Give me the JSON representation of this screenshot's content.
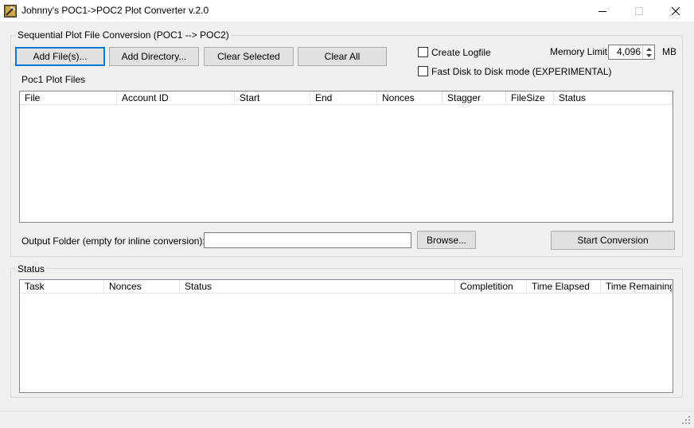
{
  "window": {
    "title": "Johnny's POC1->POC2 Plot Converter v.2.0"
  },
  "conversion_group": {
    "label": "Sequential Plot File Conversion (POC1 --> POC2)",
    "buttons": {
      "add_files": "Add File(s)...",
      "add_directory": "Add Directory...",
      "clear_selected": "Clear Selected",
      "clear_all": "Clear All"
    },
    "create_logfile": {
      "label": "Create Logfile",
      "checked": false
    },
    "fast_disk": {
      "label": "Fast Disk to Disk mode (EXPERIMENTAL)",
      "checked": false
    },
    "memory_limit": {
      "label": "Memory Limit",
      "value": "4,096",
      "unit": "MB"
    },
    "files_label": "Poc1 Plot Files",
    "file_columns": [
      "File",
      "Account ID",
      "Start",
      "End",
      "Nonces",
      "Stagger",
      "FileSize",
      "Status"
    ],
    "output_folder": {
      "label": "Output Folder (empty for inline conversion):",
      "value": ""
    },
    "browse": "Browse...",
    "start": "Start Conversion"
  },
  "status_group": {
    "label": "Status",
    "columns": [
      "Task",
      "Nonces",
      "Status",
      "Completition",
      "Time Elapsed",
      "Time Remaining"
    ]
  },
  "icons": {
    "app": "pickaxe-icon",
    "minimize": "minimize-icon",
    "maximize": "maximize-icon",
    "close": "close-icon",
    "spin_up": "chevron-up-icon",
    "spin_down": "chevron-down-icon",
    "grip": "resize-grip-icon"
  },
  "colors": {
    "accent": "#0078d7",
    "window_bg": "#f0f0f0",
    "button_bg": "#e1e1e1"
  }
}
